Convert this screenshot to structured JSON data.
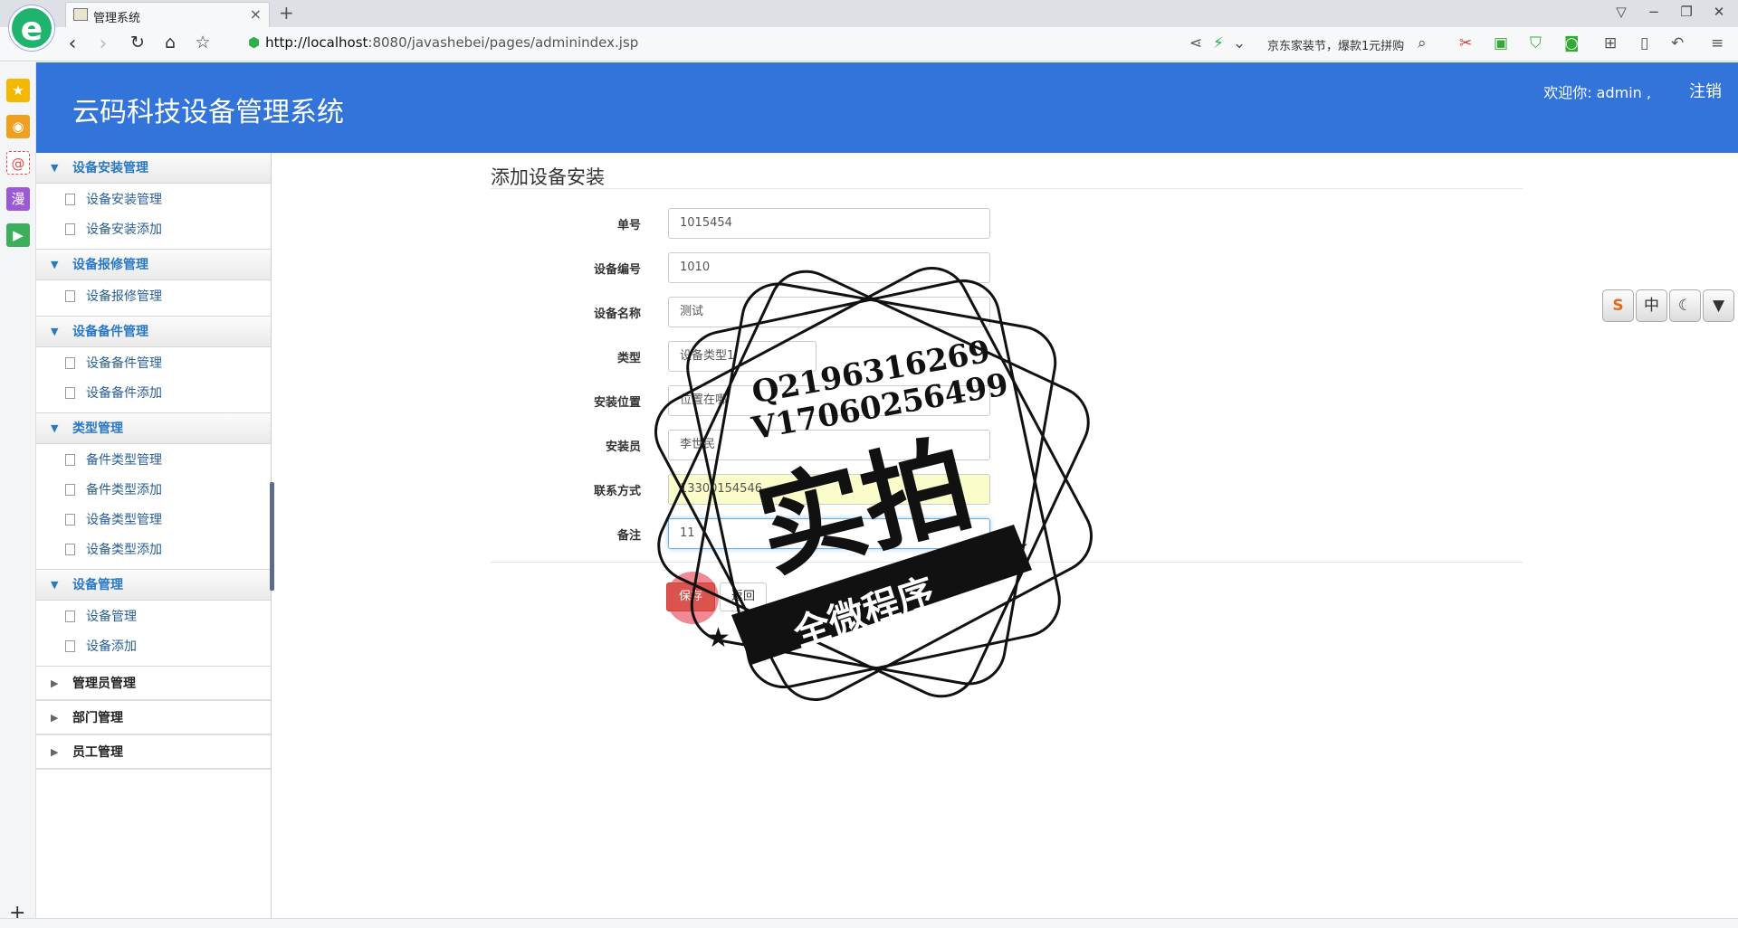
{
  "browser": {
    "logo": "e",
    "tab_title": "管理系统",
    "tab_close": "×",
    "new_tab": "+",
    "url_host": "http://localhost",
    "url_rest": ":8080/javashebei/pages/adminindex.jsp",
    "ad_text": "京东家装节，爆款1元拼购",
    "window_controls": [
      "shirt-icon",
      "minimize-icon",
      "restore-icon",
      "close-icon"
    ]
  },
  "sidebar_icons": [
    "favorites-icon",
    "weibo-icon",
    "mail-icon",
    "comic-icon",
    "video-icon"
  ],
  "sidebar_comic": "漫",
  "sidebar_add": "+",
  "header": {
    "title": "云码科技设备管理系统",
    "welcome": "欢迎你: admin ,",
    "logout": "注销"
  },
  "menu": {
    "groups": [
      {
        "label": "设备安装管理",
        "items": [
          "设备安装管理",
          "设备安装添加"
        ]
      },
      {
        "label": "设备报修管理",
        "items": [
          "设备报修管理"
        ]
      },
      {
        "label": "设备备件管理",
        "items": [
          "设备备件管理",
          "设备备件添加"
        ]
      },
      {
        "label": "类型管理",
        "items": [
          "备件类型管理",
          "备件类型添加",
          "设备类型管理",
          "设备类型添加"
        ]
      },
      {
        "label": "设备管理",
        "items": [
          "设备管理",
          "设备添加"
        ]
      }
    ],
    "collapsed": [
      "管理员管理",
      "部门管理",
      "员工管理"
    ]
  },
  "form": {
    "title": "添加设备安装",
    "fields": [
      {
        "label": "单号",
        "value": "1015454"
      },
      {
        "label": "设备编号",
        "value": "1010"
      },
      {
        "label": "设备名称",
        "value": "测试"
      },
      {
        "label": "类型",
        "value": "设备类型1"
      },
      {
        "label": "安装位置",
        "value": "位置在哪"
      },
      {
        "label": "安装员",
        "value": "李世民"
      },
      {
        "label": "联系方式",
        "value": "13300154546"
      },
      {
        "label": "备注",
        "value": "11"
      }
    ],
    "save_label": "保存",
    "back_label": "返回"
  },
  "watermark": {
    "qq": "Q2196316269",
    "wx": "V17060256499",
    "big": "实拍",
    "banner": "全微程序"
  },
  "ime": {
    "keys": [
      "S",
      "中",
      "☾",
      "👕"
    ]
  }
}
